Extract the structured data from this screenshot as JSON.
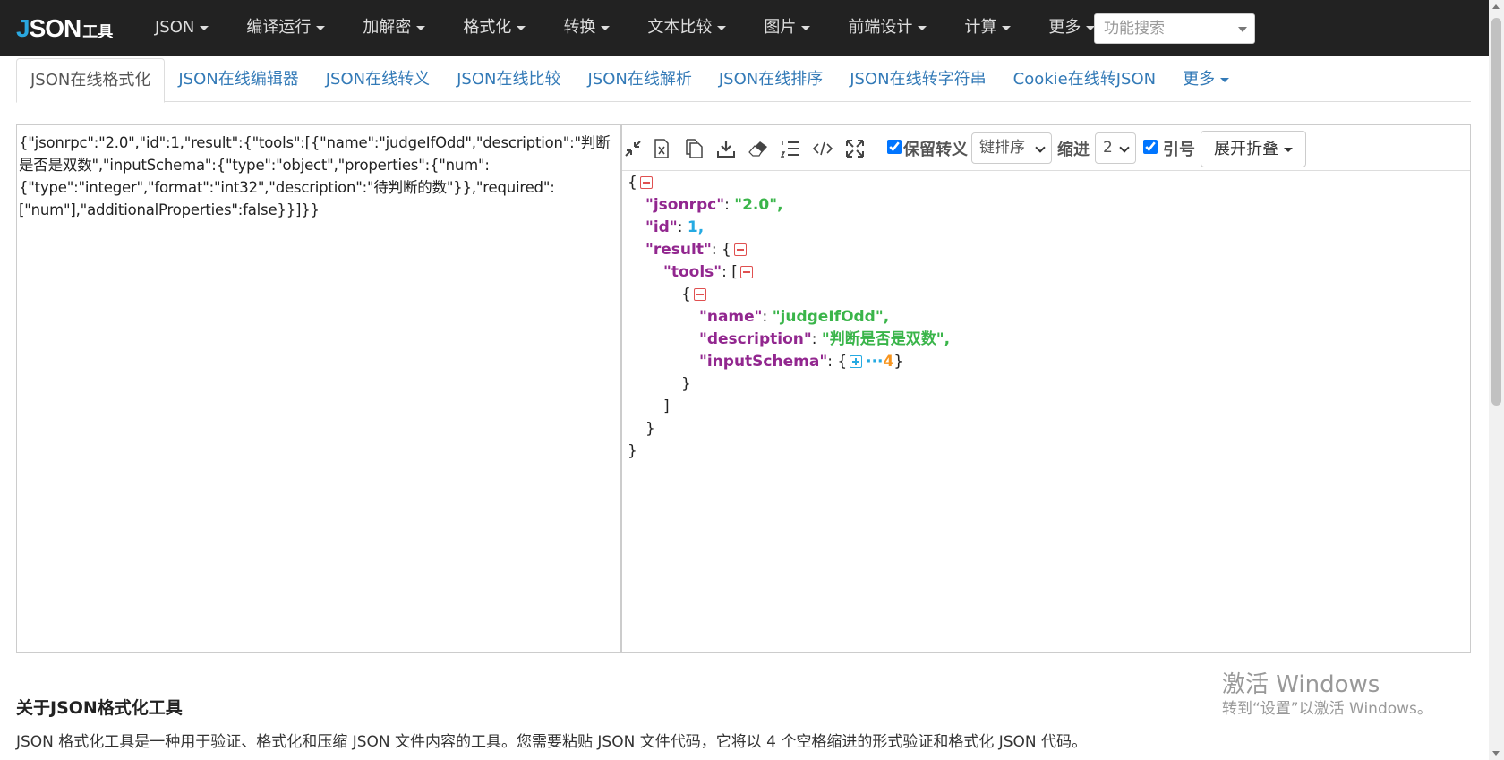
{
  "navbar": {
    "logo_main": "JSON",
    "logo_sub": "工具",
    "items": [
      {
        "label": "JSON"
      },
      {
        "label": "编译运行"
      },
      {
        "label": "加解密"
      },
      {
        "label": "格式化"
      },
      {
        "label": "转换"
      },
      {
        "label": "文本比较"
      },
      {
        "label": "图片"
      },
      {
        "label": "前端设计"
      },
      {
        "label": "计算"
      },
      {
        "label": "更多"
      }
    ],
    "search_placeholder": "功能搜索"
  },
  "tabs": [
    {
      "label": "JSON在线格式化",
      "active": true
    },
    {
      "label": "JSON在线编辑器"
    },
    {
      "label": "JSON在线转义"
    },
    {
      "label": "JSON在线比较"
    },
    {
      "label": "JSON在线解析"
    },
    {
      "label": "JSON在线排序"
    },
    {
      "label": "JSON在线转字符串"
    },
    {
      "label": "Cookie在线转JSON"
    },
    {
      "label": "更多"
    }
  ],
  "input": {
    "value": "{\"jsonrpc\":\"2.0\",\"id\":1,\"result\":{\"tools\":[{\"name\":\"judgeIfOdd\",\"description\":\"判断是否是双数\",\"inputSchema\":{\"type\":\"object\",\"properties\":{\"num\":{\"type\":\"integer\",\"format\":\"int32\",\"description\":\"待判断的数\"}},\"required\":[\"num\"],\"additionalProperties\":false}}]}}"
  },
  "toolbar": {
    "icons": [
      "compress-icon",
      "excel-icon",
      "copy-icon",
      "download-icon",
      "eraser-icon",
      "list-icon",
      "code-icon",
      "fullscreen-icon"
    ],
    "keep_escape_label": "保留转义",
    "keep_escape_checked": true,
    "sort_select": "键排序",
    "indent_label": "缩进",
    "indent_value": "2",
    "quotes_label": "引号",
    "quotes_checked": true,
    "expand_button": "展开折叠"
  },
  "tree": {
    "k_jsonrpc": "\"jsonrpc\"",
    "v_jsonrpc": "\"2.0\"",
    "k_id": "\"id\"",
    "v_id": "1",
    "k_result": "\"result\"",
    "k_tools": "\"tools\"",
    "k_name": "\"name\"",
    "v_name": "\"judgeIfOdd\"",
    "k_description": "\"description\"",
    "v_description": "\"判断是否是双数\"",
    "k_inputSchema": "\"inputSchema\"",
    "inputSchema_count": "4"
  },
  "about": {
    "title": "关于JSON格式化工具",
    "text": "JSON 格式化工具是一种用于验证、格式化和压缩 JSON 文件内容的工具。您需要粘贴 JSON 文件代码，它将以 4 个空格缩进的形式验证和格式化 JSON 代码。"
  },
  "watermark": {
    "line1": "激活 Windows",
    "line2": "转到“设置”以激活 Windows。"
  }
}
